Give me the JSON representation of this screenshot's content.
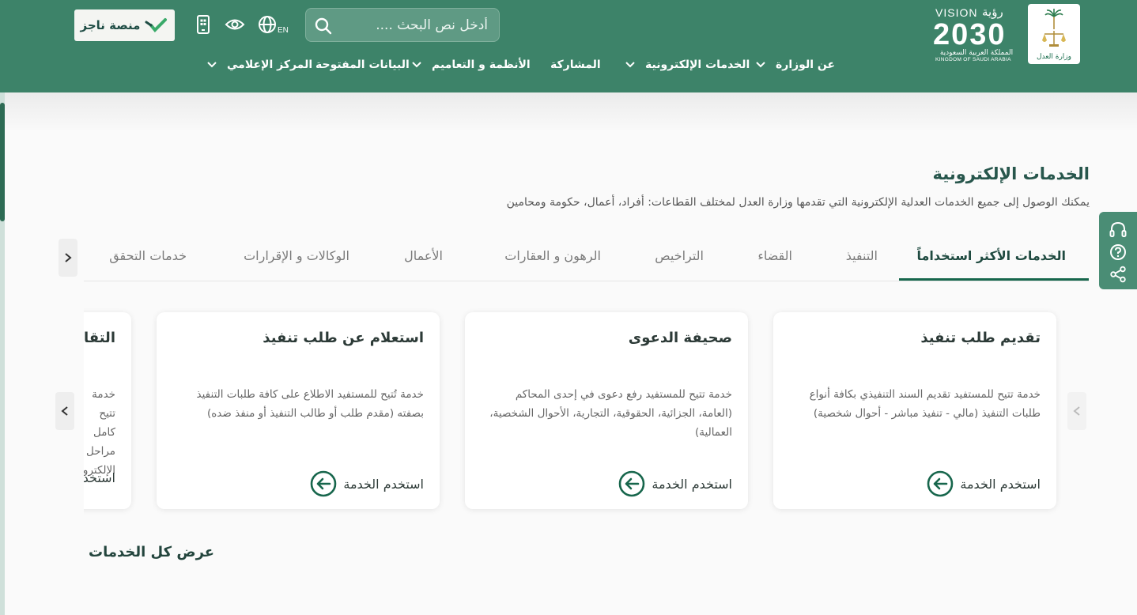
{
  "header": {
    "logo": {
      "ministry_name": "وزارة العدل",
      "vision_en": "VISION",
      "vision_ar": "رؤية",
      "vision_year": "2030",
      "kingdom_ar": "المملكة العربية السعودية",
      "kingdom_en": "KINGDOM OF SAUDI ARABIA"
    },
    "search": {
      "placeholder": "أدخل نص البحث ...."
    },
    "language_label": "EN",
    "najez": {
      "label": "منصة ناجز",
      "logo_text": "ناجز najiz"
    },
    "nav": [
      {
        "label": "عن الوزارة",
        "has_dropdown": true
      },
      {
        "label": "الخدمات الإلكترونية",
        "has_dropdown": true
      },
      {
        "label": "المشاركة",
        "has_dropdown": false
      },
      {
        "label": "الأنظمة و التعاميم",
        "has_dropdown": true
      },
      {
        "label": "البيانات المفتوحة",
        "has_dropdown": false
      },
      {
        "label": "المركز الإعلامي",
        "has_dropdown": true
      }
    ],
    "color": "#3d8369"
  },
  "section": {
    "title": "الخدمات الإلكترونية",
    "description": "يمكنك الوصول إلى جميع الخدمات العدلية الإلكترونية التي تقدمها وزارة العدل لمختلف القطاعات: أفراد، أعمال، حكومة ومحامين"
  },
  "tabs": [
    {
      "label": "الخدمات الأكثر استخداماً",
      "active": true
    },
    {
      "label": "التنفيذ",
      "active": false
    },
    {
      "label": "القضاء",
      "active": false
    },
    {
      "label": "التراخيص",
      "active": false
    },
    {
      "label": "الرهون و العقارات",
      "active": false
    },
    {
      "label": "الأعمال",
      "active": false
    },
    {
      "label": "الوكالات و الإقرارات",
      "active": false
    },
    {
      "label": "خدمات التحقق",
      "active": false
    }
  ],
  "cards": [
    {
      "title": "تقديم طلب تنفيذ",
      "description": "خدمة تتيح للمستفيد تقديم السند التنفيذي بكافة أنواع طلبات التنفيذ (مالي - تنفيذ مباشر - أحوال شخصية)",
      "cta": "استخدم الخدمة"
    },
    {
      "title": "صحيفة الدعوى",
      "description": "خدمة تتيح للمستفيد رفع دعوى في إحدى المحاكم (العامة، الجزائية، الحقوقية، التجارية، الأحوال الشخصية، العمالية)",
      "cta": "استخدم الخدمة"
    },
    {
      "title": "استعلام عن طلب تنفيذ",
      "description": "خدمة تُتيح للمستفيد الاطلاع على كافة طلبات التنفيذ بصفته (مقدم طلب أو طالب التنفيذ أو منفذ ضده)",
      "cta": "استخدم الخدمة"
    },
    {
      "title": "التقاضي",
      "description": "خدمة تتيح كامل مراحل الإلكتروني",
      "cta": "استخدم"
    }
  ],
  "view_all": "عرض كل الخدمات",
  "accent_color": "#17664c"
}
